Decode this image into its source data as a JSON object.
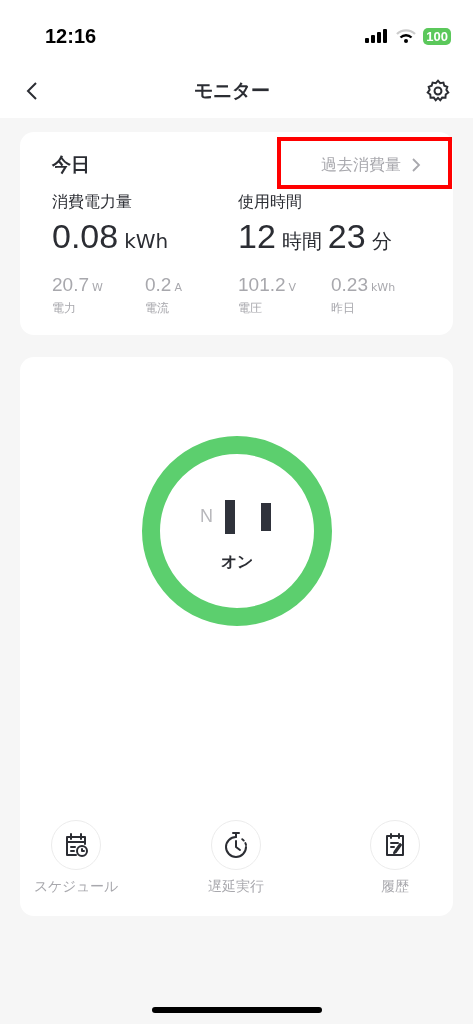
{
  "status_bar": {
    "time": "12:16",
    "battery": "100"
  },
  "nav": {
    "title": "モニター"
  },
  "today": {
    "title": "今日",
    "history_link": {
      "label": "過去消費量",
      "highlighted": true
    },
    "energy": {
      "label": "消費電力量",
      "value": "0.08",
      "unit": "kWh"
    },
    "usage_time": {
      "label": "使用時間",
      "hours": "12",
      "hours_unit": "時間",
      "minutes": "23",
      "minutes_unit": "分"
    },
    "metrics": [
      {
        "value": "20.7",
        "unit": "W",
        "label": "電力"
      },
      {
        "value": "0.2",
        "unit": "A",
        "label": "電流"
      },
      {
        "value": "101.2",
        "unit": "V",
        "label": "電圧"
      },
      {
        "value": "0.23",
        "unit": "kWh",
        "label": "昨日"
      }
    ]
  },
  "plug": {
    "on": true,
    "pole_label": "N",
    "state_label": "オン"
  },
  "actions": [
    {
      "kind": "schedule",
      "label": "スケジュール"
    },
    {
      "kind": "timer",
      "label": "遅延実行"
    },
    {
      "kind": "history",
      "label": "履歴"
    }
  ]
}
